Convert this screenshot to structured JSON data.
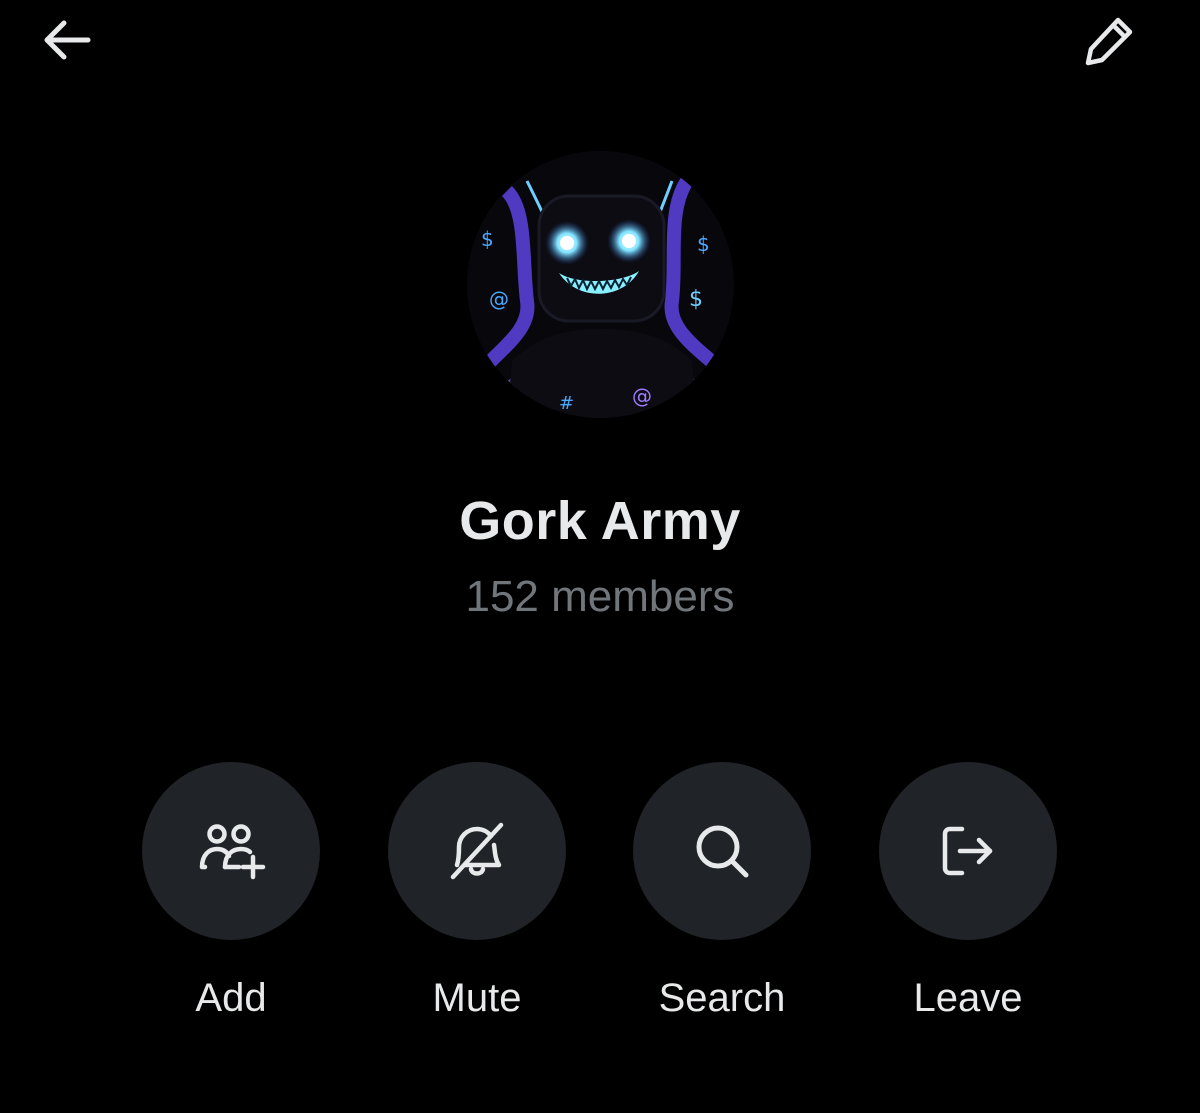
{
  "header": {
    "back_icon": "arrow-left-icon",
    "edit_icon": "pencil-icon"
  },
  "group": {
    "name": "Gork Army",
    "members": "152 members",
    "avatar": "robot-drawing-avatar"
  },
  "actions": [
    {
      "label": "Add",
      "icon": "add-people-icon"
    },
    {
      "label": "Mute",
      "icon": "bell-off-icon"
    },
    {
      "label": "Search",
      "icon": "search-icon"
    },
    {
      "label": "Leave",
      "icon": "leave-icon"
    }
  ],
  "colors": {
    "background": "#000000",
    "primary_text": "#e7e9ea",
    "secondary_text": "#71767b",
    "button_bg": "#202327"
  }
}
